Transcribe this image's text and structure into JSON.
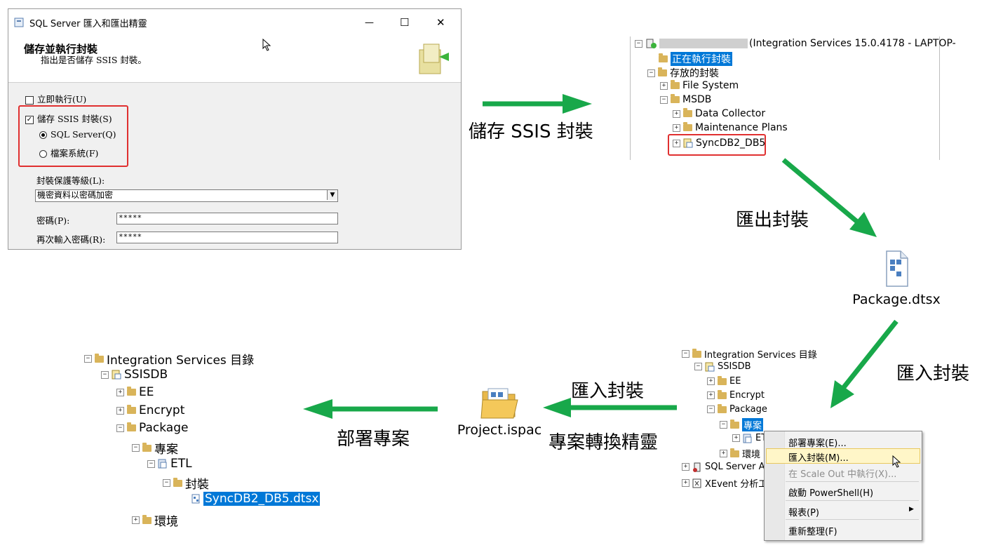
{
  "dialog": {
    "title": "SQL Server 匯入和匯出精靈",
    "heading": "儲存並執行封裝",
    "subheading": "指出是否儲存 SSIS 封裝。",
    "run_now": "立即執行(U)",
    "save_ssis": "儲存 SSIS 封裝(S)",
    "sql_server": "SQL Server(Q)",
    "file_system": "檔案系統(F)",
    "protection_label": "封裝保護等級(L):",
    "protection_value": "機密資料以密碼加密",
    "password_label": "密碼(P):",
    "password_value": "*****",
    "repassword_label": "再次輸入密碼(R):",
    "repassword_value": "*****",
    "minimize": "—",
    "maximize": "☐",
    "close": "✕"
  },
  "arrow_labels": {
    "save": "儲存 SSIS 封裝",
    "export": "匯出封裝",
    "import_right": "匯入封裝",
    "import_mid": "匯入封裝",
    "wizard": "專案轉換精靈",
    "deploy": "部署專案"
  },
  "tree_integration": {
    "root": "(Integration Services 15.0.4178 - LAPTOP-",
    "running": "正在執行封裝",
    "stored": "存放的封裝",
    "file_system": "File System",
    "msdb": "MSDB",
    "data_collector": "Data Collector",
    "maintenance": "Maintenance Plans",
    "sync": "SyncDB2_DB5"
  },
  "files": {
    "dtsx": "Package.dtsx",
    "ispac": "Project.ispac"
  },
  "tree_catalog_right": {
    "root": "Integration Services 目錄",
    "ssisdb": "SSISDB",
    "ee": "EE",
    "encrypt": "Encrypt",
    "package": "Package",
    "project": "專案",
    "etl": "ET",
    "env": "環境",
    "sqlserver": "SQL Server A",
    "xevent": "XEvent 分析工"
  },
  "context_menu": {
    "deploy": "部署專案(E)...",
    "import": "匯入封裝(M)...",
    "scale_out": "在 Scale Out 中執行(X)...",
    "powershell": "啟動 PowerShell(H)",
    "reports": "報表(P)",
    "refresh": "重新整理(F)"
  },
  "tree_catalog_left": {
    "root": "Integration Services 目錄",
    "ssisdb": "SSISDB",
    "ee": "EE",
    "encrypt": "Encrypt",
    "package": "Package",
    "project": "專案",
    "etl": "ETL",
    "packages": "封裝",
    "sync": "SyncDB2_DB5.dtsx",
    "env": "環境"
  },
  "colors": {
    "arrow": "#18a84a",
    "highlight": "#e03030",
    "select": "#0078d7"
  }
}
